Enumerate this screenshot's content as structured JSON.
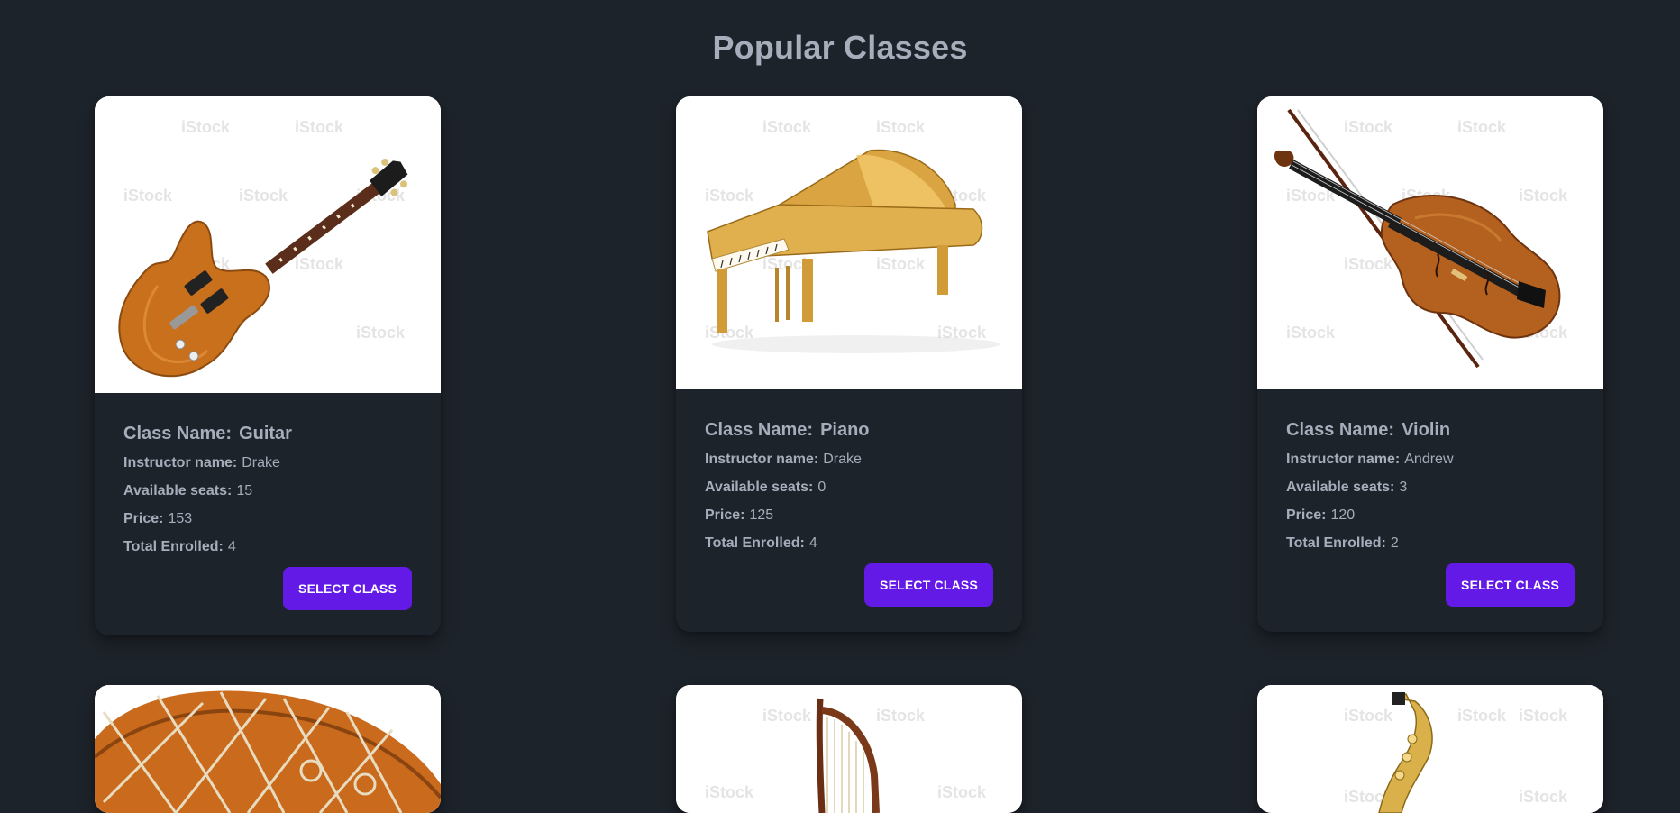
{
  "page": {
    "title": "Popular Classes"
  },
  "colors": {
    "background": "#1d232a",
    "text": "#a6adbb",
    "button": "#641ae6",
    "button_text": "#ffffff"
  },
  "labels": {
    "class_name": "Class Name:",
    "instructor": "Instructor name:",
    "seats": "Available seats:",
    "price": "Price:",
    "enrolled": "Total Enrolled:",
    "select_button": "SELECT CLASS"
  },
  "classes": [
    {
      "name": "Guitar",
      "image_icon": "guitar-icon",
      "instructor": "Drake",
      "seats": "15",
      "price": "153",
      "enrolled": "4"
    },
    {
      "name": "Piano",
      "image_icon": "piano-icon",
      "instructor": "Drake",
      "seats": "0",
      "price": "125",
      "enrolled": "4"
    },
    {
      "name": "Violin",
      "image_icon": "violin-icon",
      "instructor": "Andrew",
      "seats": "3",
      "price": "120",
      "enrolled": "2"
    },
    {
      "image_icon": "drum-icon"
    },
    {
      "image_icon": "harp-icon"
    },
    {
      "image_icon": "saxophone-icon"
    }
  ],
  "watermark": "iStock"
}
